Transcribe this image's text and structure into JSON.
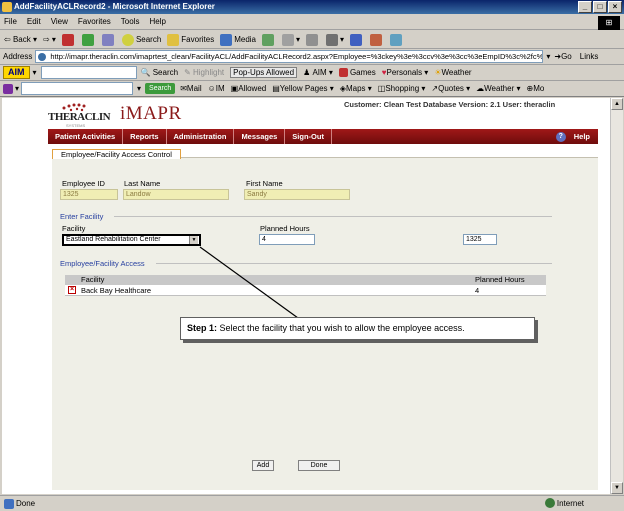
{
  "window": {
    "title": "AddFacilityACLRecord2 - Microsoft Internet Explorer"
  },
  "menu": [
    "File",
    "Edit",
    "View",
    "Favorites",
    "Tools",
    "Help"
  ],
  "toolbar": {
    "back": "Back",
    "search": "Search",
    "favorites": "Favorites",
    "media": "Media"
  },
  "address": {
    "label": "Address",
    "url": "http://imapr.theraclin.com/imaprtest_clean/FacilityACL/AddFacilityACLRecord2.aspx?Employee=%3ckey%3e%3ccv%3e%3cc%3eEmpID%3c%2fc%3e",
    "go": "Go",
    "links": "Links"
  },
  "aim_bar": {
    "logo": "AIM",
    "search": "Search",
    "highlight": "Highlight",
    "popups": "Pop-Ups Allowed",
    "aim": "AIM",
    "games": "Games",
    "personals": "Personals",
    "weather": "Weather"
  },
  "yahoo_bar": {
    "search_button": "Search",
    "mail": "Mail",
    "im": "IM",
    "allowed": "Allowed",
    "yellow_pages": "Yellow Pages",
    "maps": "Maps",
    "shopping": "Shopping",
    "quotes": "Quotes",
    "weather": "Weather",
    "more": "Mo"
  },
  "header": {
    "logo_thera": "THERACLIN",
    "logo_sub": "SYSTEMS",
    "logo_imapr": "iMAPR",
    "customer_info": "Customer: Clean Test Database Version: 2.1 User: theraclin"
  },
  "nav": {
    "items": [
      "Patient Activities",
      "Reports",
      "Administration",
      "Messages",
      "Sign-Out"
    ],
    "help": "Help"
  },
  "tab": {
    "label": "Employee/Facility Access Control"
  },
  "employee": {
    "id_label": "Employee ID",
    "id_value": "1325",
    "last_label": "Last Name",
    "last_value": "Landow",
    "first_label": "First Name",
    "first_value": "Sandy"
  },
  "enter_facility": {
    "section_title": "Enter Facility",
    "facility_label": "Facility",
    "facility_value": "Eastland Rehabilitation Center",
    "hours_label": "Planned Hours",
    "hours_value": "4",
    "extra_value": "1325"
  },
  "access": {
    "section_title": "Employee/Facility Access",
    "columns": [
      "Facility",
      "Planned Hours"
    ],
    "rows": [
      {
        "facility": "Back Bay Healthcare",
        "hours": "4"
      }
    ]
  },
  "callout": {
    "step": "Step 1:",
    "text": " Select the facility that you wish to allow the employee access."
  },
  "buttons": {
    "add": "Add",
    "done": "Done"
  },
  "status": {
    "left": "Done",
    "zone": "Internet"
  }
}
